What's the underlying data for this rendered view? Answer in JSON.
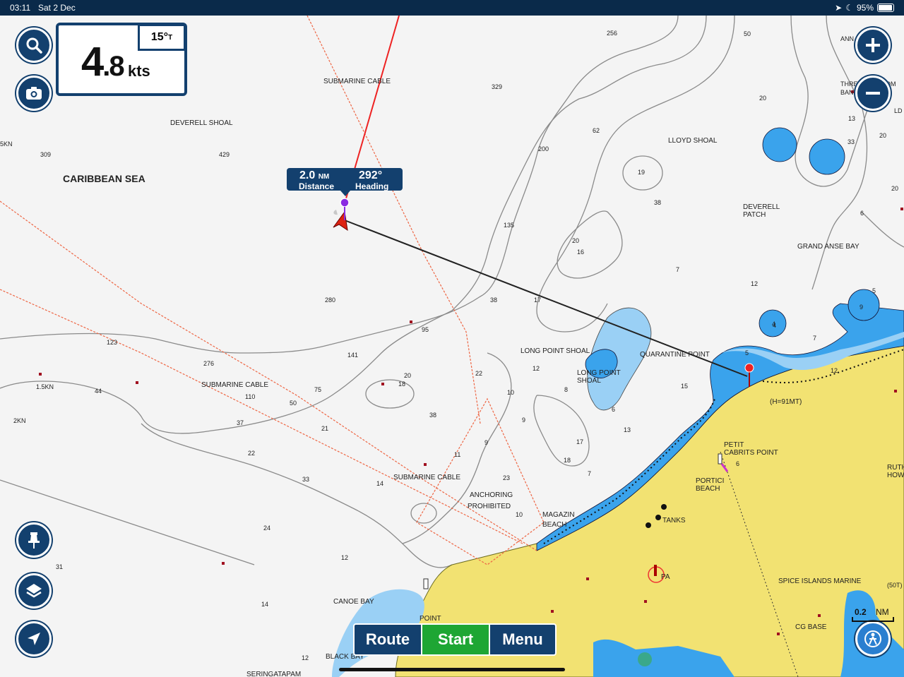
{
  "status_bar": {
    "time": "03:11",
    "date": "Sat 2 Dec",
    "battery": "95%"
  },
  "speed": {
    "value_int": "4",
    "value_dec": ".8",
    "unit": "kts",
    "heading": "15°",
    "heading_ref": "T"
  },
  "callout": {
    "distance": "2.0",
    "distance_unit": "NM",
    "distance_label": "Distance",
    "heading": "292°",
    "heading_label": "Heading"
  },
  "bottom_bar": {
    "route_label": "Route",
    "start_label": "Start",
    "menu_label": "Menu"
  },
  "scale": {
    "value": "0.2",
    "unit": "NM"
  },
  "map_labels": {
    "caribbean_sea": "CARIBBEAN SEA",
    "deverell_shoal": "DEVERELL SHOAL",
    "submarine_cable_1": "SUBMARINE CABLE",
    "submarine_cable_2": "SUBMARINE CABLE",
    "submarine_cable_3": "SUBMARINE CABLE",
    "lloyd_shoal": "LLOYD SHOAL",
    "deverell_patch_1": "DEVERELL",
    "deverell_patch_2": "PATCH",
    "grand_anse_bay": "GRAND ANSE BAY",
    "long_point_shoal": "LONG POINT SHOAL",
    "long_point_1": "LONG POINT",
    "long_point_2": "SHOAL",
    "quarantine_point": "QUARANTINE POINT",
    "h91mt": "(H=91MT)",
    "petit_1": "PETIT",
    "petit_2": "CABRITS POINT",
    "portici_1": "PORTICI",
    "portici_2": "BEACH",
    "anchoring_1": "ANCHORING",
    "anchoring_2": "PROHIBITED",
    "magazin_1": "MAGAZIN",
    "magazin_2": "BEACH",
    "tanks": "TANKS",
    "pa": "PA",
    "spice": "SPICE ISLANDS MARINE",
    "cg_base": "CG BASE",
    "canoe_bay": "CANOE BAY",
    "black_bay": "BLACK BAY",
    "point": "POINT",
    "seringatapam": "SERINGATAPAM",
    "kn_15": "1.5KN",
    "kn_2": "2KN",
    "kn_5": "5KN",
    "ruth_1": "RUTH",
    "ruth_2": "HOW",
    "ann": "ANN",
    "three_1": "THREE",
    "three_2": "BAN",
    "ld": "LD",
    "om": "OM",
    "t50": "(50T)"
  },
  "depths": [
    "256",
    "50",
    "329",
    "62",
    "200",
    "19",
    "38",
    "309",
    "429",
    "135",
    "20",
    "16",
    "280",
    "95",
    "38",
    "123",
    "141",
    "276",
    "20",
    "18",
    "44",
    "75",
    "110",
    "50",
    "37",
    "21",
    "22",
    "33",
    "14",
    "24",
    "31",
    "12",
    "14",
    "12",
    "38",
    "11",
    "22",
    "12",
    "10",
    "17",
    "13",
    "15",
    "7",
    "12",
    "20",
    "17",
    "18",
    "7",
    "10",
    "23",
    "6",
    "5",
    "33",
    "13",
    "20",
    "20",
    "7",
    "4",
    "9",
    "12",
    "5",
    "6",
    "8",
    "9",
    "9",
    "4",
    "6"
  ]
}
